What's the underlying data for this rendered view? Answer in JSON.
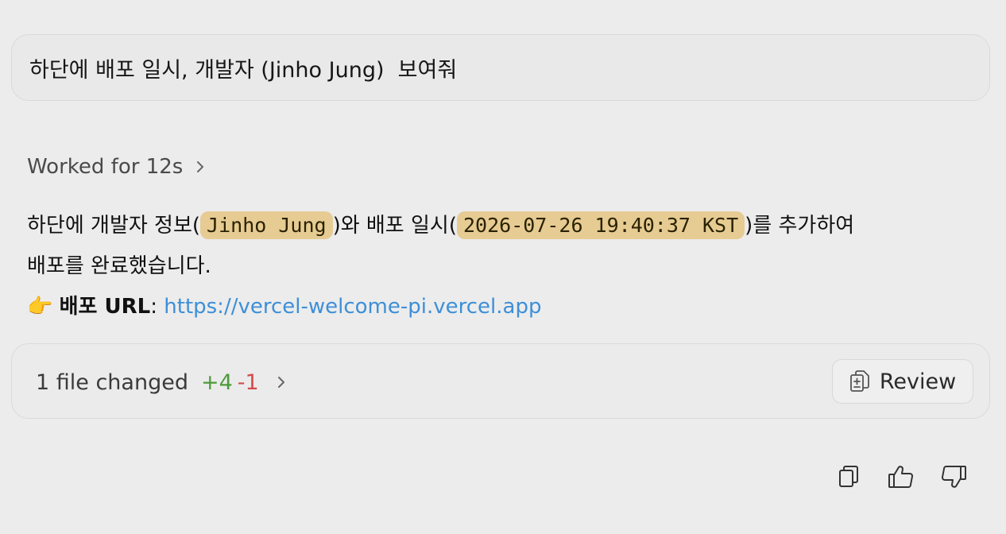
{
  "user_message": {
    "text": "하단에 배포 일시, 개발자 (Jinho Jung)  보여줘"
  },
  "worked": {
    "label": "Worked for 12s",
    "icon": "chevron-right-icon"
  },
  "assistant_message": {
    "part1": "하단에 개발자 정보(",
    "developer": "Jinho Jung",
    "part2": ")와 배포 일시(",
    "deploy_time": "2026-07-26 19:40:37 KST",
    "part3": ")를 추가하여",
    "part4": "배포를 완료했습니다.",
    "url_emoji": "👉",
    "url_label": "배포 URL",
    "url_sep": ": ",
    "url": "https://vercel-welcome-pi.vercel.app"
  },
  "files": {
    "summary": "1 file changed",
    "additions": "+4",
    "deletions": "-1",
    "review_label": "Review",
    "review_icon": "document-copy-icon"
  },
  "message_actions": {
    "copy_icon": "copy-icon",
    "thumbs_up_icon": "thumbs-up-icon",
    "thumbs_down_icon": "thumbs-down-icon"
  },
  "colors": {
    "code_bg": "#e6cb93",
    "link": "#3d8fd8",
    "additions": "#4e9a3a",
    "deletions": "#d44b4b"
  }
}
